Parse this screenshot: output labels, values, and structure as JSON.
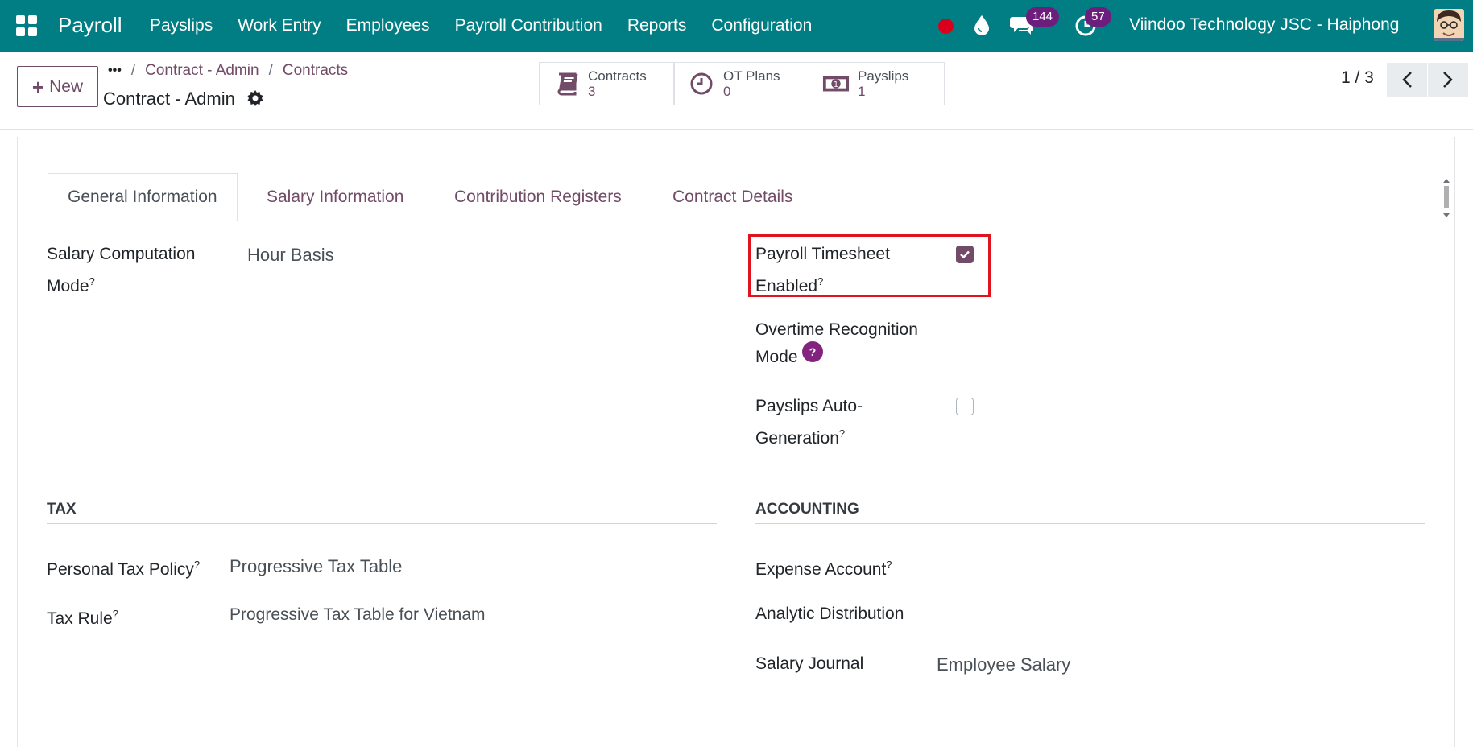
{
  "navbar": {
    "brand": "Payroll",
    "menu": [
      "Payslips",
      "Work Entry",
      "Employees",
      "Payroll Contribution",
      "Reports",
      "Configuration"
    ],
    "messages_count": "144",
    "activities_count": "57",
    "company": "Viindoo Technology JSC - Haiphong",
    "bg_color": "#017e84"
  },
  "control": {
    "new_label": "New",
    "dots": "•••",
    "breadcrumb": [
      "Contract - Admin",
      "Contracts"
    ],
    "breadcrumb_sep": "/",
    "title": "Contract - Admin",
    "smart_buttons": [
      {
        "label": "Contracts",
        "value": "3",
        "icon": "book-icon"
      },
      {
        "label": "OT Plans",
        "value": "0",
        "icon": "clock-icon"
      },
      {
        "label": "Payslips",
        "value": "1",
        "icon": "money-icon"
      }
    ],
    "pager": "1 / 3"
  },
  "tabs": [
    "General Information",
    "Salary Information",
    "Contribution Registers",
    "Contract Details"
  ],
  "general": {
    "salary_computation_mode_label_1": "Salary Computation",
    "salary_computation_mode_label_2": "Mode",
    "salary_computation_mode_value": "Hour Basis",
    "payroll_timesheet_label_1": "Payroll Timesheet",
    "payroll_timesheet_label_2": "Enabled",
    "payroll_timesheet_enabled": true,
    "overtime_label_1": "Overtime Recognition",
    "overtime_label_2": "Mode",
    "payslips_auto_label_1": "Payslips Auto-",
    "payslips_auto_label_2": "Generation",
    "payslips_auto_enabled": false,
    "help_mark": "?"
  },
  "tax": {
    "title": "TAX",
    "personal_tax_policy_label": "Personal Tax Policy",
    "personal_tax_policy_value": "Progressive Tax Table",
    "tax_rule_label": "Tax Rule",
    "tax_rule_value": "Progressive Tax Table for Vietnam"
  },
  "accounting": {
    "title": "ACCOUNTING",
    "expense_account_label": "Expense Account",
    "analytic_distribution_label": "Analytic Distribution",
    "salary_journal_label": "Salary Journal",
    "salary_journal_value": "Employee Salary"
  },
  "colors": {
    "accent": "#714b67",
    "highlight": "#e0141e",
    "help_badge": "#82247f"
  }
}
